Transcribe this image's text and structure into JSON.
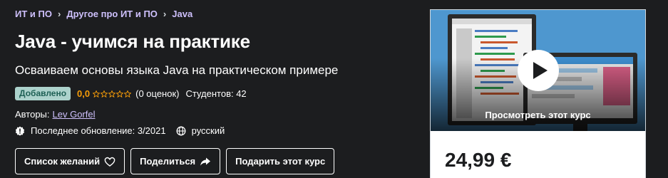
{
  "breadcrumb": [
    "ИТ и ПО",
    "Другое про ИТ и ПО",
    "Java"
  ],
  "course": {
    "title": "Java - учимся на практике",
    "subtitle": "Осваиваем основы языка Java на практическом примере",
    "badge": "Добавлено",
    "rating": "0,0",
    "rating_value": 0,
    "rating_count": "(0 оценок)",
    "students": "Студентов: 42",
    "authors_label": "Авторы:",
    "author": "Lev Gorfel",
    "last_updated": "Последнее обновление: 3/2021",
    "language": "русский"
  },
  "actions": {
    "wishlist": "Список желаний",
    "share": "Поделиться",
    "gift": "Подарить этот курс"
  },
  "sidebar": {
    "preview_label": "Просмотреть этот курс",
    "price": "24,99 €"
  },
  "colors": {
    "background": "#1c1d1f",
    "link": "#cec0fc",
    "rating": "#f69c08",
    "badge_bg": "#acd2cc",
    "badge_text": "#1e6055"
  },
  "icons": {
    "updated": "alert-badge-icon",
    "language": "globe-icon",
    "wishlist": "heart-icon",
    "share": "share-arrow-icon",
    "play": "play-icon"
  }
}
